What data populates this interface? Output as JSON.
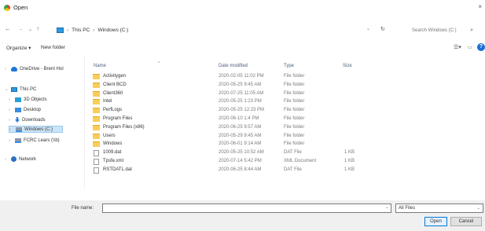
{
  "window": {
    "title": "Open",
    "close_glyph": "×"
  },
  "address": {
    "back": "←",
    "forward": "→",
    "up_arrow": "↑",
    "recent": "⌄",
    "crumbs": [
      "This PC",
      "Windows (C:)"
    ],
    "separator": "›",
    "search_placeholder": "Search Windows (C:)"
  },
  "toolbar": {
    "organize": "Organize ▾",
    "new_folder": "New folder",
    "help": "?"
  },
  "nav": {
    "items": [
      {
        "label": "OneDrive - Brent Hol",
        "icon": "onedrive-icon"
      },
      {
        "label": "This PC",
        "icon": "this-pc-icon"
      },
      {
        "label": "3D Objects",
        "icon": "3d-objects-icon"
      },
      {
        "label": "Desktop",
        "icon": "desktop-icon"
      },
      {
        "label": "Downloads",
        "icon": "downloads-icon"
      },
      {
        "label": "Windows (C:)",
        "icon": "drive-icon"
      },
      {
        "label": "FCRC Lears (\\\\b)",
        "icon": "network-drive-icon"
      },
      {
        "label": "Network",
        "icon": "network-icon"
      }
    ]
  },
  "columns": {
    "name": "Name",
    "date": "Date modified",
    "type": "Type",
    "size": "Size"
  },
  "files": [
    {
      "name": "Activitygen",
      "date": "2020-02-05 11:02 PM",
      "type": "File folder",
      "size": "",
      "kind": "folder"
    },
    {
      "name": "Client BCD",
      "date": "2020-05-25 9:45 AM",
      "type": "File folder",
      "size": "",
      "kind": "folder"
    },
    {
      "name": "Client360",
      "date": "2020-07-25 11:05 AM",
      "type": "File folder",
      "size": "",
      "kind": "folder"
    },
    {
      "name": "Intel",
      "date": "2020-05-25 1:23 PM",
      "type": "File folder",
      "size": "",
      "kind": "folder"
    },
    {
      "name": "PerfLogs",
      "date": "2020-05-25 12:23 PM",
      "type": "File folder",
      "size": "",
      "kind": "folder"
    },
    {
      "name": "Program Files",
      "date": "2020-06-10 1:4 PM",
      "type": "File folder",
      "size": "",
      "kind": "folder"
    },
    {
      "name": "Program Files (x86)",
      "date": "2020-06-25 9:57 AM",
      "type": "File folder",
      "size": "",
      "kind": "folder"
    },
    {
      "name": "Users",
      "date": "2020-05-29 9:45 AM",
      "type": "File folder",
      "size": "",
      "kind": "folder"
    },
    {
      "name": "Windows",
      "date": "2020-06-01 9:14 AM",
      "type": "File folder",
      "size": "",
      "kind": "folder"
    },
    {
      "name": "1009.dat",
      "date": "2020-05-25 10:52 AM",
      "type": "DAT File",
      "size": "1 KB",
      "kind": "file"
    },
    {
      "name": "Tpsfe.xml",
      "date": "2020-07-14 5:42 PM",
      "type": "XML Document",
      "size": "1 KB",
      "kind": "file"
    },
    {
      "name": "RSTDATL.dat",
      "date": "2020-06-25 8:44 AM",
      "type": "DAT File",
      "size": "1 KB",
      "kind": "file"
    }
  ],
  "footer": {
    "file_name_label": "File name:",
    "file_name_value": "",
    "file_type": "All Files",
    "open": "Open",
    "cancel": "Cancel"
  }
}
